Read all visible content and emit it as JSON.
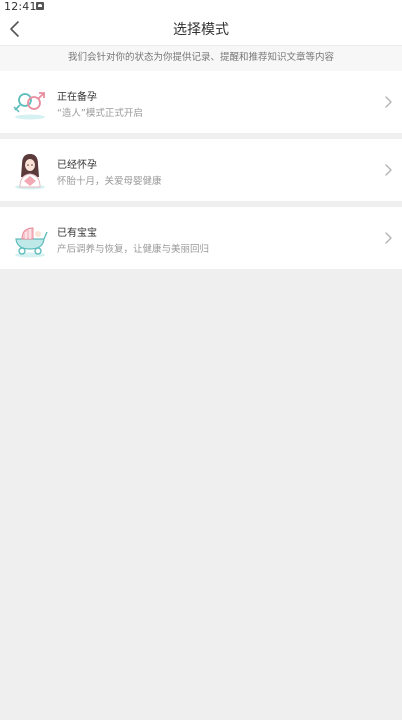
{
  "status_bar": {
    "time": "12:41"
  },
  "nav": {
    "title": "选择模式"
  },
  "tip": {
    "text": "我们会针对你的状态为你提供记录、提醒和推荐知识文章等内容"
  },
  "modes": [
    {
      "title": "正在备孕",
      "description": "“造人”模式正式开启",
      "icon": "gender-symbols-icon"
    },
    {
      "title": "已经怀孕",
      "description": "怀胎十月，关爱母婴健康",
      "icon": "pregnant-woman-icon"
    },
    {
      "title": "已有宝宝",
      "description": "产后调养与恢复，让健康与美丽回归",
      "icon": "baby-stroller-icon"
    }
  ],
  "colors": {
    "background": "#efefef",
    "card": "#ffffff",
    "accent_teal": "#7fcfcf",
    "accent_pink": "#f2a9b3"
  }
}
